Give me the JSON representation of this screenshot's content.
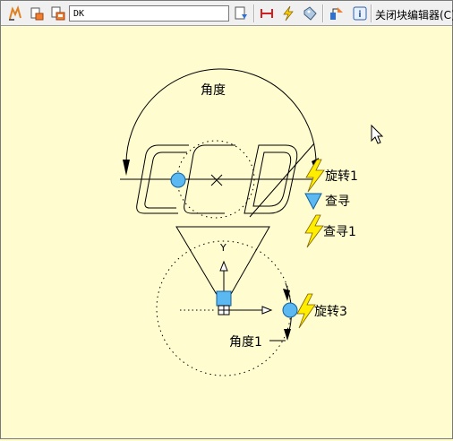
{
  "toolbar": {
    "block_name": "DK",
    "close_label": "关闭块编辑器(C)",
    "buttons": [
      "edit-block-icon",
      "save-block-icon",
      "save-block-as-icon",
      "auth-block-icon",
      "parameter-icon",
      "action-icon",
      "parameter-set-icon",
      "visibility-state-icon",
      "info-icon"
    ]
  },
  "canvas": {
    "param_angle": "角度",
    "param_angle1": "角度1",
    "action_rotate1": "旋转1",
    "action_lookup": "查寻",
    "action_lookup1": "查寻1",
    "action_rotate3": "旋转3",
    "axis_y": "Y"
  },
  "colors": {
    "canvas_bg": "#fffdd0",
    "grip": "#5bb8f0",
    "lightning": "#ffee00"
  }
}
